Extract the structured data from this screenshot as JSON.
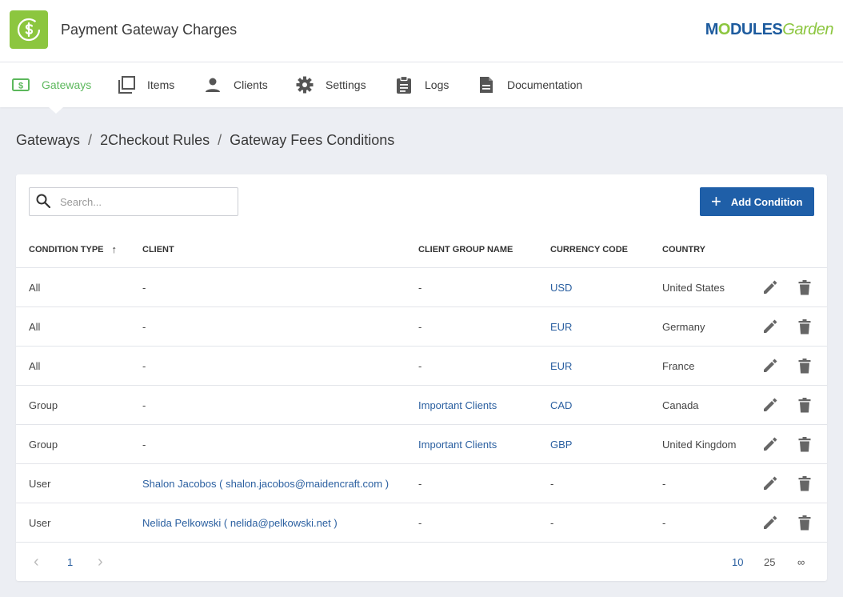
{
  "app": {
    "title": "Payment Gateway Charges",
    "brand_a": "M",
    "brand_o": "O",
    "brand_b": "DULES",
    "brand_c": "Garden"
  },
  "nav": [
    {
      "label": "Gateways",
      "icon": "money-icon",
      "active": true
    },
    {
      "label": "Items",
      "icon": "layers-icon"
    },
    {
      "label": "Clients",
      "icon": "person-icon"
    },
    {
      "label": "Settings",
      "icon": "gear-icon"
    },
    {
      "label": "Logs",
      "icon": "clipboard-icon"
    },
    {
      "label": "Documentation",
      "icon": "document-icon"
    }
  ],
  "breadcrumb": [
    "Gateways",
    "2Checkout Rules",
    "Gateway Fees Conditions"
  ],
  "breadcrumb_sep": "/",
  "search": {
    "placeholder": "Search..."
  },
  "add_button": {
    "label": "Add Condition"
  },
  "table": {
    "columns": [
      "Condition Type",
      "Client",
      "Client Group Name",
      "Currency Code",
      "Country"
    ],
    "rows": [
      {
        "type": "All",
        "client": "-",
        "group": "-",
        "currency": "USD",
        "country": "United States"
      },
      {
        "type": "All",
        "client": "-",
        "group": "-",
        "currency": "EUR",
        "country": "Germany"
      },
      {
        "type": "All",
        "client": "-",
        "group": "-",
        "currency": "EUR",
        "country": "France"
      },
      {
        "type": "Group",
        "client": "-",
        "group": "Important Clients",
        "currency": "CAD",
        "country": "Canada"
      },
      {
        "type": "Group",
        "client": "-",
        "group": "Important Clients",
        "currency": "GBP",
        "country": "United Kingdom"
      },
      {
        "type": "User",
        "client": "Shalon Jacobos ( shalon.jacobos@maidencraft.com )",
        "group": "-",
        "currency": "-",
        "country": "-"
      },
      {
        "type": "User",
        "client": "Nelida Pelkowski ( nelida@pelkowski.net )",
        "group": "-",
        "currency": "-",
        "country": "-"
      }
    ]
  },
  "pagination": {
    "prev": "‹",
    "page": "1",
    "next": "›",
    "sizes": [
      "10",
      "25",
      "∞"
    ],
    "active_size": "10"
  },
  "colors": {
    "accent_green": "#5cb85c",
    "primary_blue": "#1f5fa8",
    "link_blue": "#2a5fa0"
  }
}
